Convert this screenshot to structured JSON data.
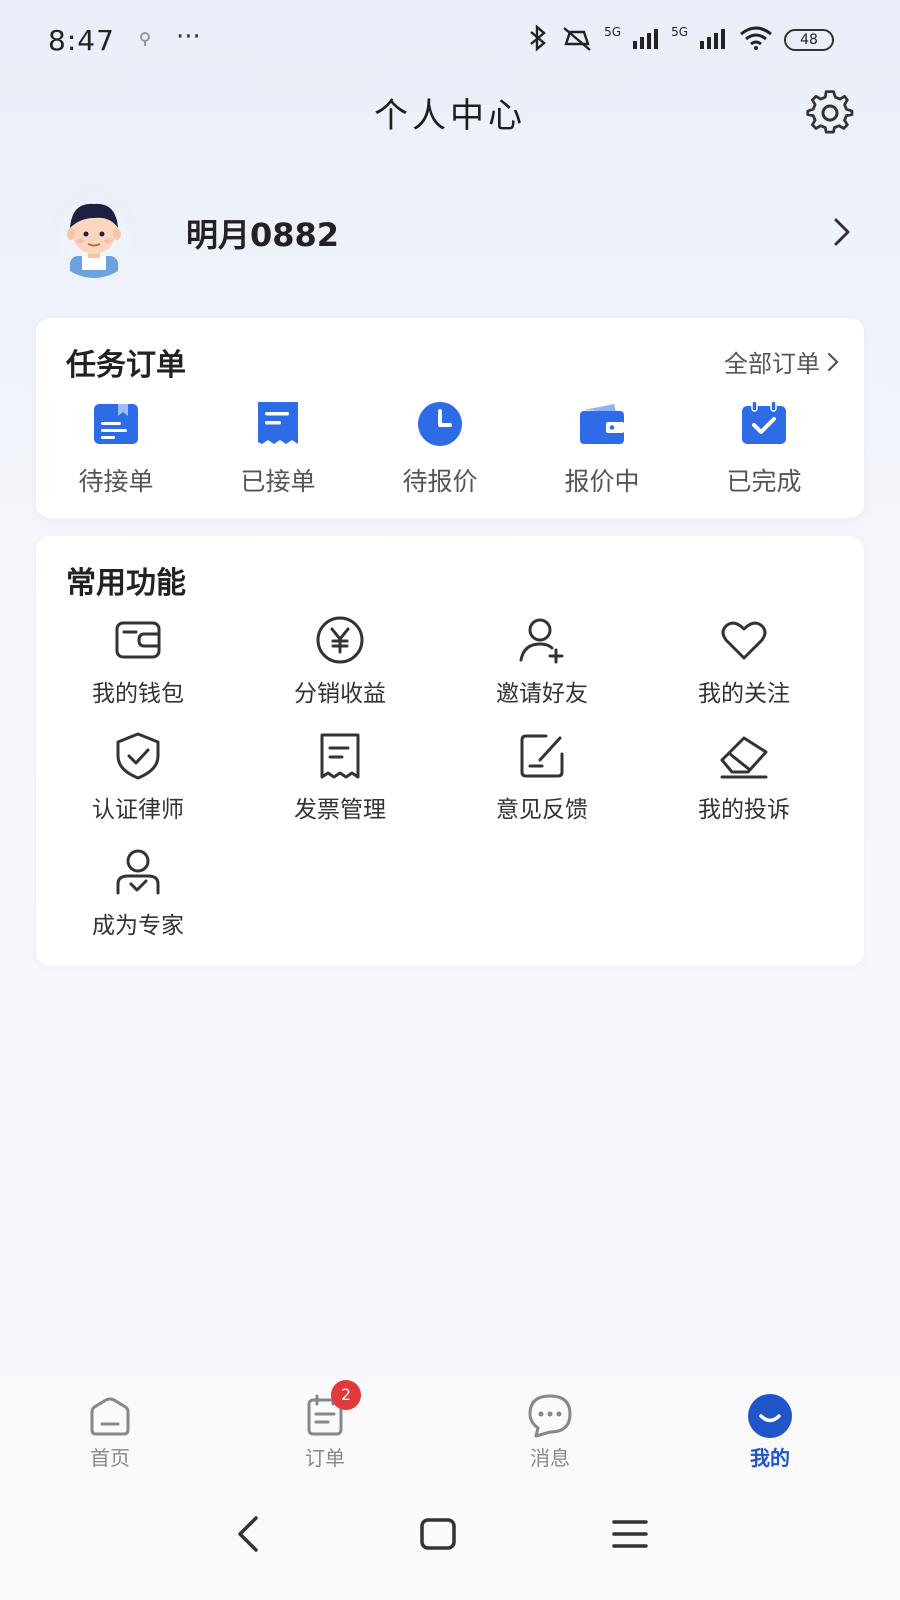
{
  "status_bar": {
    "time": "8:47",
    "dots": "···",
    "network_1": "5G",
    "network_2": "5G",
    "battery": "48"
  },
  "header": {
    "title": "个人中心",
    "settings_icon": "gear-icon"
  },
  "profile": {
    "username": "明月0882",
    "avatar_icon": "avatar-boy-icon",
    "chevron_icon": "chevron-right-icon"
  },
  "orders": {
    "title": "任务订单",
    "all_orders_label": "全部订单",
    "items": [
      {
        "label": "待接单",
        "icon": "pending-order-icon"
      },
      {
        "label": "已接单",
        "icon": "accepted-order-icon"
      },
      {
        "label": "待报价",
        "icon": "clock-icon"
      },
      {
        "label": "报价中",
        "icon": "wallet-icon"
      },
      {
        "label": "已完成",
        "icon": "calendar-check-icon"
      }
    ]
  },
  "functions": {
    "title": "常用功能",
    "items": [
      {
        "label": "我的钱包",
        "icon": "wallet-outline-icon"
      },
      {
        "label": "分销收益",
        "icon": "yen-icon"
      },
      {
        "label": "邀请好友",
        "icon": "add-user-icon"
      },
      {
        "label": "我的关注",
        "icon": "heart-icon"
      },
      {
        "label": "认证律师",
        "icon": "shield-check-icon"
      },
      {
        "label": "发票管理",
        "icon": "invoice-icon"
      },
      {
        "label": "意见反馈",
        "icon": "feedback-edit-icon"
      },
      {
        "label": "我的投诉",
        "icon": "eraser-icon"
      },
      {
        "label": "成为专家",
        "icon": "expert-user-icon"
      }
    ]
  },
  "bottom_nav": {
    "items": [
      {
        "label": "首页",
        "icon": "home-icon",
        "active": false
      },
      {
        "label": "订单",
        "icon": "order-list-icon",
        "active": false,
        "badge": "2"
      },
      {
        "label": "消息",
        "icon": "message-icon",
        "active": false
      },
      {
        "label": "我的",
        "icon": "profile-smile-icon",
        "active": true
      }
    ]
  },
  "colors": {
    "accent": "#1f55c9",
    "icon_blue": "#2e6be6",
    "badge_red": "#e23a3a"
  }
}
